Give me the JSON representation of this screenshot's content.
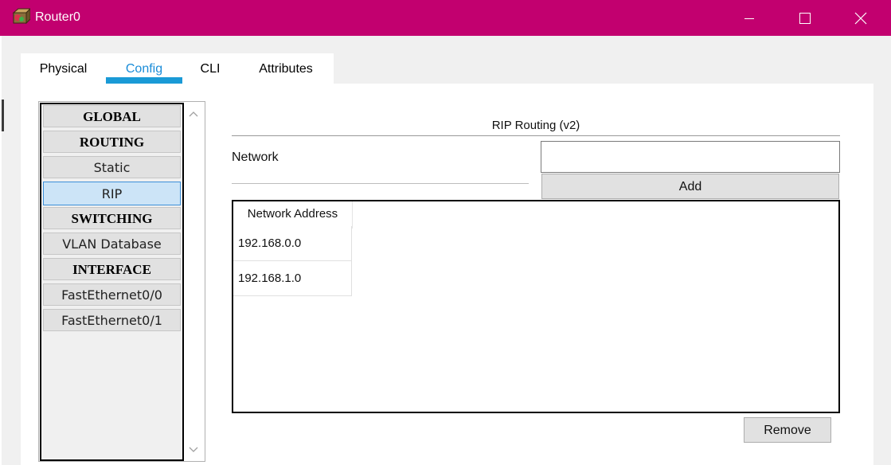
{
  "window": {
    "title": "Router0",
    "icon": "router-icon",
    "title_bar_color": "#c2006f"
  },
  "tabs": [
    {
      "label": "Physical",
      "active": false
    },
    {
      "label": "Config",
      "active": true
    },
    {
      "label": "CLI",
      "active": false
    },
    {
      "label": "Attributes",
      "active": false
    }
  ],
  "menu": {
    "items": [
      {
        "label": "GLOBAL",
        "type": "header"
      },
      {
        "label": "ROUTING",
        "type": "header"
      },
      {
        "label": "Static",
        "type": "item"
      },
      {
        "label": "RIP",
        "type": "item",
        "selected": true
      },
      {
        "label": "SWITCHING",
        "type": "header"
      },
      {
        "label": "VLAN Database",
        "type": "item"
      },
      {
        "label": "INTERFACE",
        "type": "header"
      },
      {
        "label": "FastEthernet0/0",
        "type": "item"
      },
      {
        "label": "FastEthernet0/1",
        "type": "item"
      }
    ]
  },
  "rip": {
    "section_title": "RIP Routing (v2)",
    "network_label": "Network",
    "network_value": "",
    "add_label": "Add",
    "remove_label": "Remove",
    "table": {
      "column_header": "Network Address",
      "rows": [
        "192.168.0.0",
        "192.168.1.0"
      ]
    }
  },
  "colors": {
    "accent": "#1a9ad6",
    "selected_item": "#cce4f7"
  }
}
